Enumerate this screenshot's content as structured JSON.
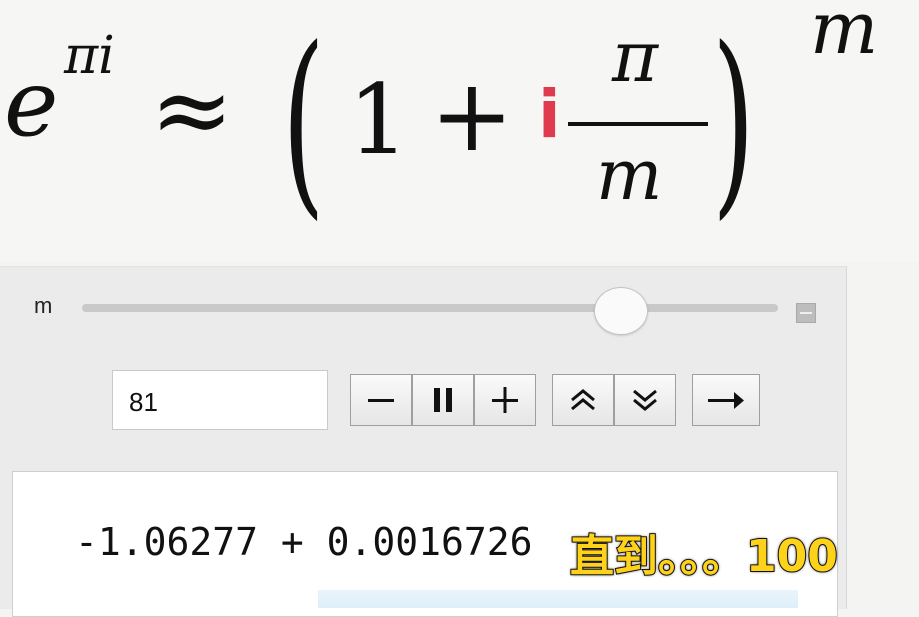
{
  "formula": {
    "base": "e",
    "exponent": "πi",
    "approx": "≈",
    "one": "1",
    "plus": "+",
    "imag": "i",
    "numerator": "π",
    "denominator": "m",
    "power": "m",
    "lparen": "(",
    "rparen": ")"
  },
  "controls": {
    "slider_label": "m",
    "slider_value": 81,
    "input_value": "81",
    "buttons": [
      "decrement",
      "pause",
      "increment",
      "faster",
      "slower",
      "direction"
    ]
  },
  "output": {
    "result": "-1.06277 + 0.0016726"
  },
  "caption": "直到。。。100",
  "colors": {
    "imag_unit": "#e03a4f",
    "caption_text": "#ffd21a",
    "panel_bg": "#ebebeb"
  }
}
